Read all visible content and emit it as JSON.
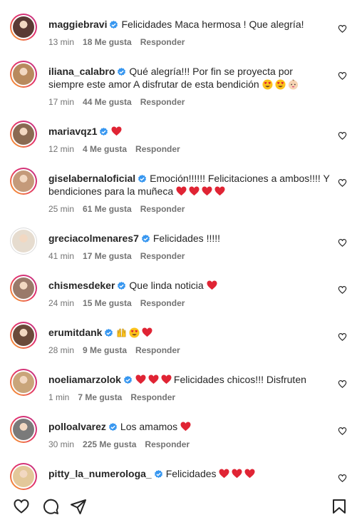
{
  "colors": {
    "verified": "#3897f0",
    "heart_red": "#ed4956",
    "meta_gray": "#737373",
    "text": "#262626"
  },
  "icons": {
    "verified": "verified-badge-icon",
    "like": "heart-outline-icon",
    "comment": "comment-icon",
    "share": "share-paper-plane-icon",
    "save": "bookmark-icon"
  },
  "comments": [
    {
      "username": "maggiebravi",
      "verified": true,
      "text": "Felicidades Maca hermosa ! Que alegría!",
      "emojis": [],
      "time": "13 min",
      "likes": "18 Me gusta",
      "reply": "Responder",
      "avatar_color": "#5a3a34"
    },
    {
      "username": "iliana_calabro",
      "verified": true,
      "text": "Qué alegría!!! Por fin se proyecta por siempre este amor A disfrutar de esta bendición",
      "emojis": [
        "heart-eyes",
        "heart-eyes",
        "baby"
      ],
      "time": "17 min",
      "likes": "44 Me gusta",
      "reply": "Responder",
      "avatar_color": "#b88a5e"
    },
    {
      "username": "mariavqz1",
      "verified": true,
      "text": "",
      "emojis": [
        "red-heart"
      ],
      "time": "12 min",
      "likes": "4 Me gusta",
      "reply": "Responder",
      "avatar_color": "#8a6a52"
    },
    {
      "username": "giselabernaloficial",
      "verified": true,
      "text": "Emoción!!!!!! Felicitaciones a ambos!!!! Y bendiciones para la muñeca",
      "emojis": [
        "red-heart",
        "red-heart",
        "red-heart",
        "red-heart"
      ],
      "time": "25 min",
      "likes": "61 Me gusta",
      "reply": "Responder",
      "avatar_color": "#c49a7a"
    },
    {
      "username": "greciacolmenares7",
      "verified": true,
      "text": "Felicidades !!!!!",
      "emojis": [],
      "time": "41 min",
      "likes": "17 Me gusta",
      "reply": "Responder",
      "avatar_color": "#e6dccf"
    },
    {
      "username": "chismesdeker",
      "verified": true,
      "text": "Que linda noticia",
      "emojis": [
        "red-heart"
      ],
      "time": "24 min",
      "likes": "15 Me gusta",
      "reply": "Responder",
      "avatar_color": "#9a7a6a"
    },
    {
      "username": "erumitdank",
      "verified": true,
      "text": "",
      "emojis": [
        "hands-raised",
        "heart-eyes",
        "red-heart"
      ],
      "time": "28 min",
      "likes": "9 Me gusta",
      "reply": "Responder",
      "avatar_color": "#6a4a3a"
    },
    {
      "username": "noeliamarzolok",
      "verified": true,
      "text": "Felicidades chicos!!! Disfruten",
      "emojis_before": [
        "red-heart",
        "red-heart",
        "red-heart"
      ],
      "emojis": [],
      "time": "1 min",
      "likes": "7 Me gusta",
      "reply": "Responder",
      "avatar_color": "#c9a57a"
    },
    {
      "username": "polloalvarez",
      "verified": true,
      "text": "Los amamos",
      "emojis": [
        "red-heart"
      ],
      "time": "30 min",
      "likes": "225 Me gusta",
      "reply": "Responder",
      "avatar_color": "#7a7a7a"
    },
    {
      "username": "pitty_la_numerologa_",
      "verified": true,
      "text": "Felicidades",
      "emojis": [
        "red-heart",
        "red-heart",
        "red-heart"
      ],
      "time": "",
      "likes": "",
      "reply": "",
      "avatar_color": "#e3c89a"
    }
  ]
}
